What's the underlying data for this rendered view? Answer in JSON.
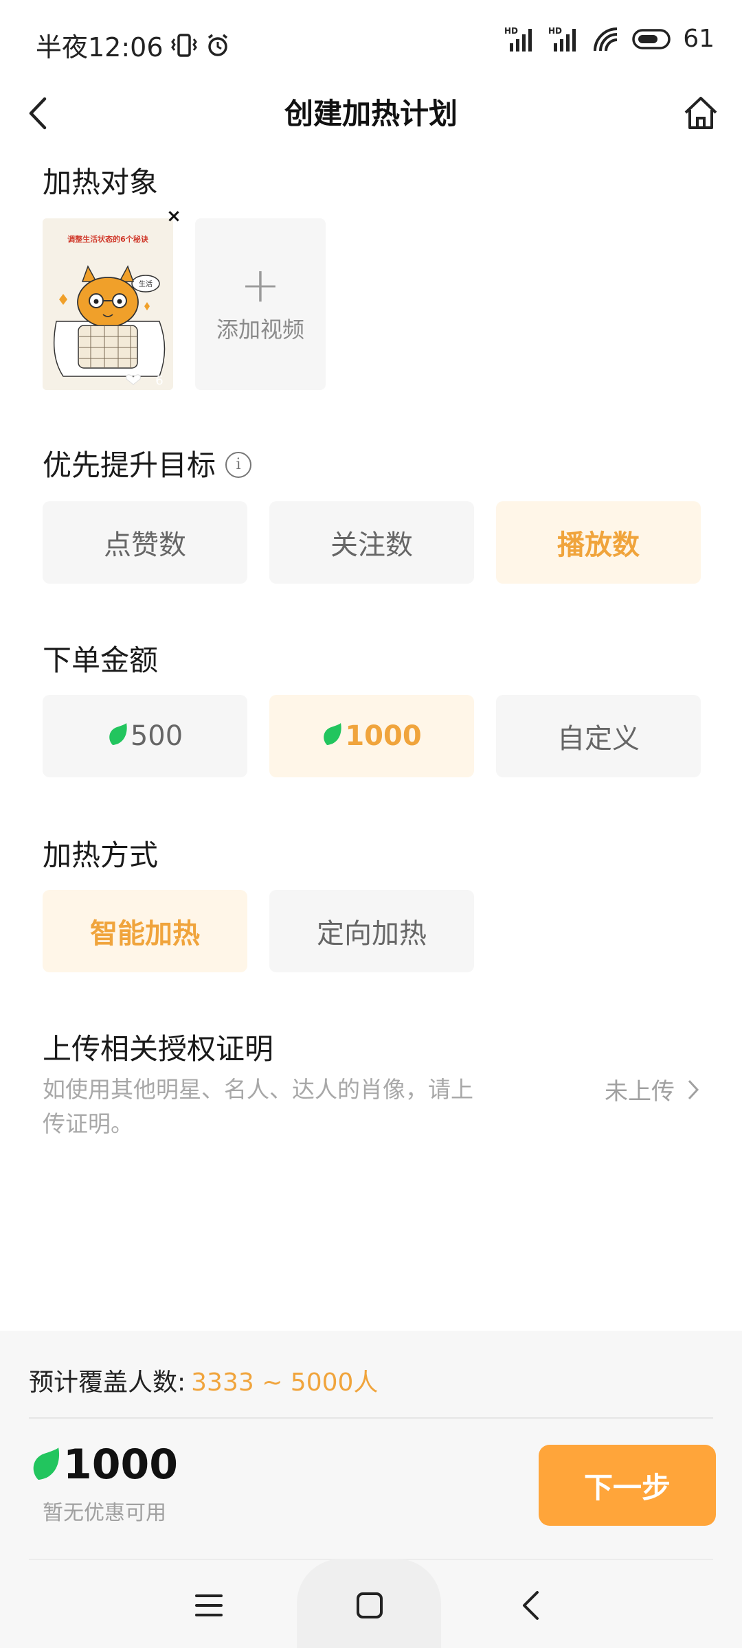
{
  "status_bar": {
    "time": "半夜12:06",
    "battery": "61",
    "signal1_label": "HD",
    "signal2_label": "HD"
  },
  "nav": {
    "title": "创建加热计划"
  },
  "target": {
    "section_title": "加热对象",
    "thumb_caption": "调整生活状态的6个秘诀",
    "thumb_bubble": "生活",
    "thumb_likes": "6",
    "add_label": "添加视频"
  },
  "goal": {
    "section_title": "优先提升目标",
    "info_glyph": "i",
    "options": [
      "点赞数",
      "关注数",
      "播放数"
    ],
    "selected_index": 2
  },
  "amount": {
    "section_title": "下单金额",
    "options": [
      "500",
      "1000",
      "自定义"
    ],
    "selected_index": 1
  },
  "method": {
    "section_title": "加热方式",
    "options": [
      "智能加热",
      "定向加热"
    ],
    "selected_index": 0
  },
  "upload": {
    "title": "上传相关授权证明",
    "description": "如使用其他明星、名人、达人的肖像，请上传证明。",
    "status": "未上传"
  },
  "footer": {
    "reach_label": "预计覆盖人数:",
    "reach_value": "3333 ~ 5000人",
    "price": "1000",
    "discount": "暂无优惠可用",
    "next_label": "下一步"
  },
  "colors": {
    "accent": "#f0a43c",
    "accent_bg": "#fff6e8",
    "button": "#ffa53a",
    "leaf": "#22c55e"
  },
  "icons": [
    "vibrate-icon",
    "alarm-icon",
    "signal-icon",
    "wifi-icon",
    "battery-icon",
    "back-icon",
    "home-icon",
    "info-icon",
    "plus-icon",
    "leaf-coin-icon",
    "chevron-right-icon",
    "menu-icon",
    "square-icon",
    "triangle-back-icon"
  ]
}
